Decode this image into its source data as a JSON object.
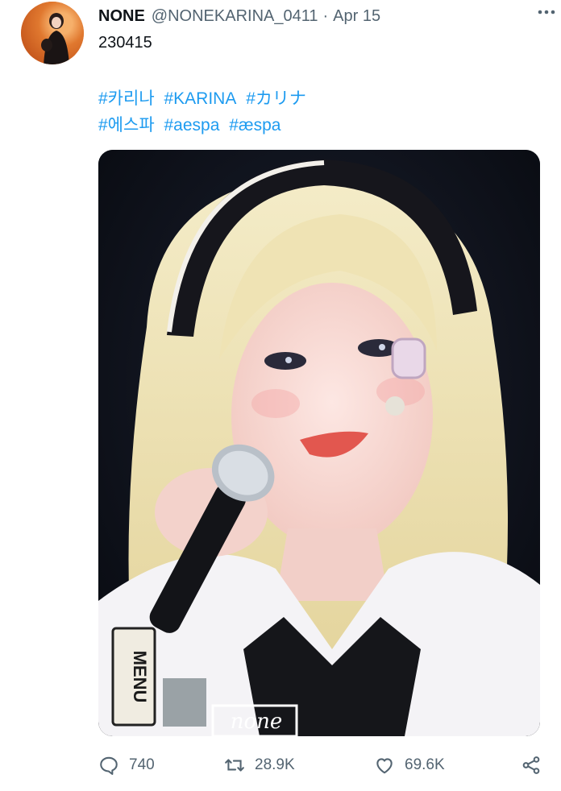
{
  "tweet": {
    "author_name": "NONE",
    "handle": "@NONEKARINA_0411",
    "separator": "·",
    "date": "Apr 15",
    "text": "230415",
    "hashtags_line1": [
      "#카리나",
      "#KARINA",
      "#カリナ"
    ],
    "hashtags_line2": [
      "#에스파",
      "#aespa",
      "#æspa"
    ]
  },
  "media": {
    "alt": "photo",
    "sign_text": "MENU",
    "watermark": "none"
  },
  "actions": {
    "reply_count": "740",
    "retweet_count": "28.9K",
    "like_count": "69.6K"
  },
  "icons": {
    "more": "more-dots-icon",
    "reply": "reply-icon",
    "retweet": "retweet-icon",
    "like": "heart-icon",
    "share": "share-icon"
  },
  "colors": {
    "hashtag": "#1d9bf0",
    "secondary_text": "#536471",
    "primary_text": "#0f1419",
    "avatar_bg": "#e07a32"
  }
}
